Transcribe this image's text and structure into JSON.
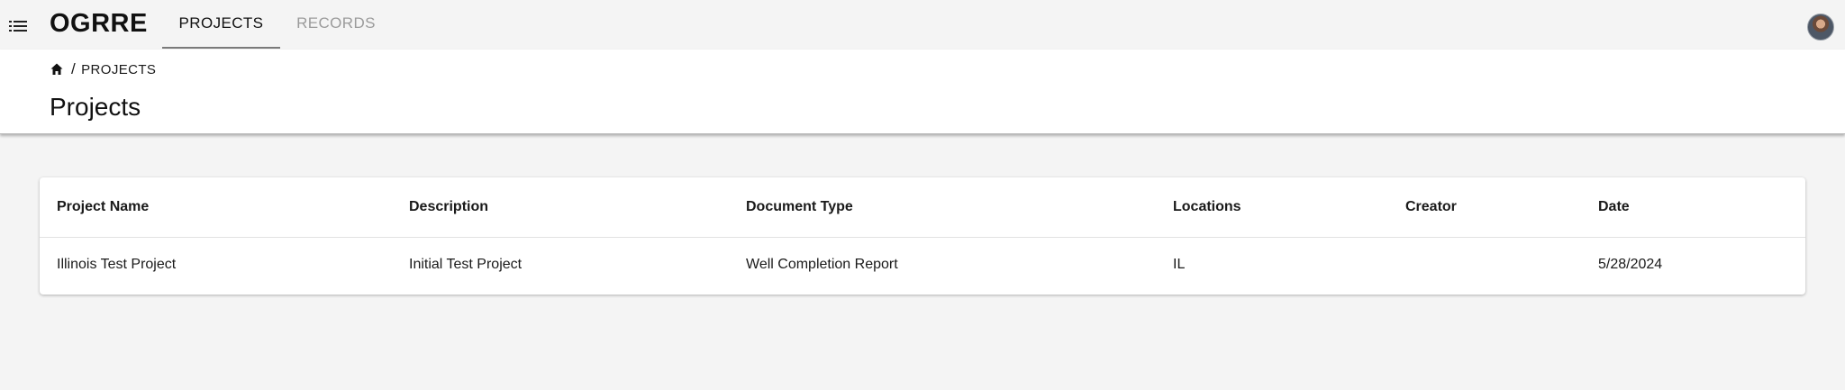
{
  "app": {
    "brand": "OGRRE",
    "menu_icon": "menu-list-icon",
    "avatar_icon": "user-avatar"
  },
  "nav": {
    "tabs": [
      {
        "label": "PROJECTS",
        "active": true
      },
      {
        "label": "RECORDS",
        "active": false
      }
    ]
  },
  "breadcrumb": {
    "home_icon": "home-icon",
    "separator": "/",
    "current": "PROJECTS"
  },
  "page": {
    "title": "Projects"
  },
  "table": {
    "columns": [
      "Project Name",
      "Description",
      "Document Type",
      "Locations",
      "Creator",
      "Date"
    ],
    "rows": [
      {
        "project_name": "Illinois Test Project",
        "description": "Initial Test Project",
        "document_type": "Well Completion Report",
        "locations": "IL",
        "creator": "",
        "date": "5/28/2024"
      }
    ]
  },
  "colors": {
    "background": "#f4f4f4",
    "panel": "#ffffff",
    "active_tab_text": "#111111",
    "inactive_tab_text": "#9b9b9b",
    "tab_underline": "#7a7a7a"
  }
}
